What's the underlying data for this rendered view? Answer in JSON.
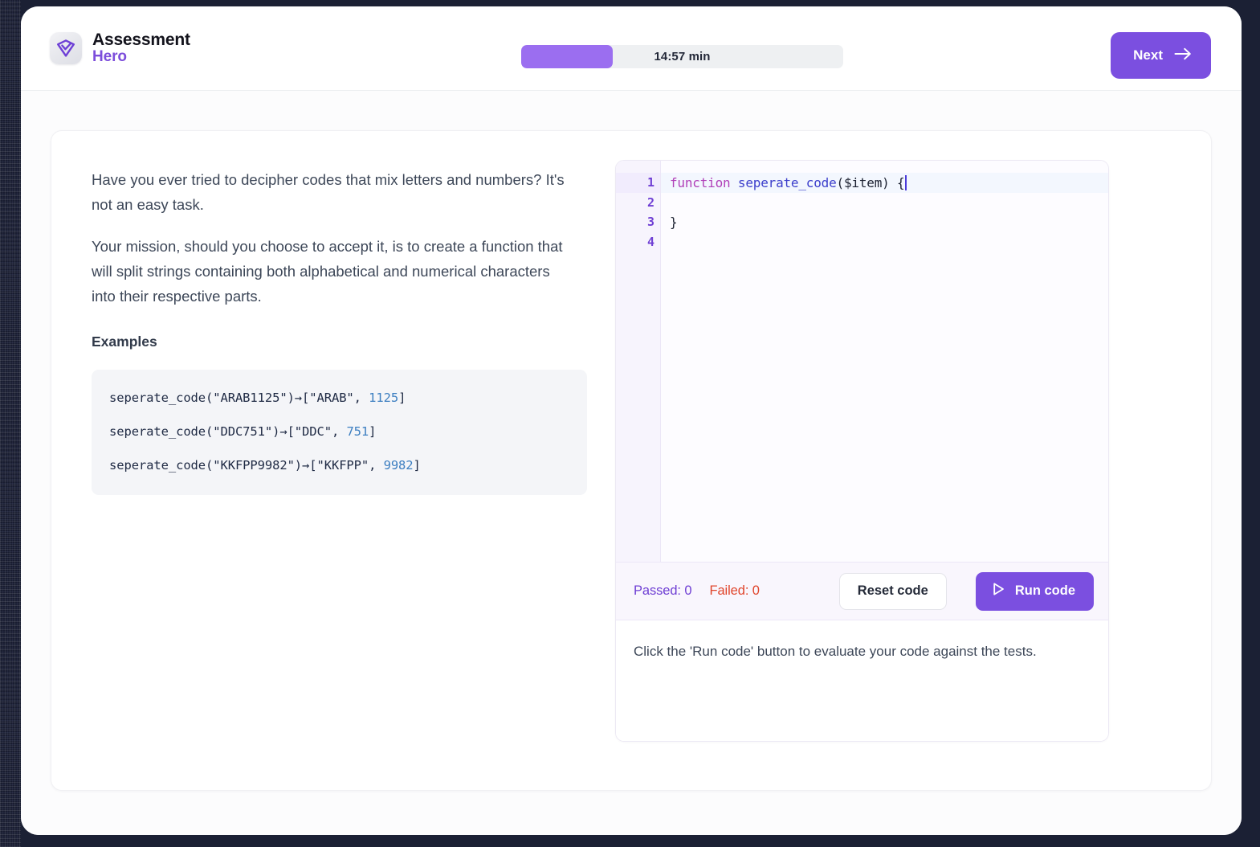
{
  "brand": {
    "icon": "shield-check-logo-icon",
    "line1": "Assessment",
    "line2": "Hero",
    "accent_color": "#7c4ddb"
  },
  "header": {
    "timer": {
      "label": "14:57 min",
      "progress_percent": 28.5,
      "fill_color": "#9b6ef0",
      "track_color": "#eef0f2"
    },
    "next_button": {
      "label": "Next",
      "icon": "arrow-right-icon",
      "color": "#7b4fe0"
    }
  },
  "prompt": {
    "paragraphs": [
      "Have you ever tried to decipher codes that mix letters and numbers? It's not an easy task.",
      "Your mission, should you choose to accept it, is to create a function that will split strings containing both alphabetical and numerical characters into their respective parts."
    ],
    "examples_heading": "Examples",
    "examples": [
      {
        "call": "seperate_code(\"ARAB1125\")",
        "arrow": "→",
        "result_prefix": "[\"ARAB\", ",
        "result_number": "1125",
        "result_suffix": "]"
      },
      {
        "call": "seperate_code(\"DDC751\")",
        "arrow": "→",
        "result_prefix": "[\"DDC\", ",
        "result_number": "751",
        "result_suffix": "]"
      },
      {
        "call": "seperate_code(\"KKFPP9982\")",
        "arrow": "→",
        "result_prefix": "[\"KKFPP\", ",
        "result_number": "9982",
        "result_suffix": "]"
      }
    ]
  },
  "editor": {
    "line_numbers": [
      "1",
      "2",
      "3",
      "4"
    ],
    "fold_icon": "chevron-down-icon",
    "active_line": "1",
    "code": {
      "line1_keyword": "function",
      "line1_space": " ",
      "line1_fn_name": "seperate_code",
      "line1_rest": "($item) {",
      "line2": "",
      "line3": "}",
      "line4": ""
    },
    "status": {
      "passed_label": "Passed: 0",
      "failed_label": "Failed: 0",
      "passed_color": "#6f3fd4",
      "failed_color": "#e0452c"
    },
    "reset_button": {
      "label": "Reset code"
    },
    "run_button": {
      "label": "Run code",
      "icon": "play-icon",
      "color": "#7b4fe0"
    },
    "output_text": "Click the 'Run code' button to evaluate your code against the tests."
  }
}
